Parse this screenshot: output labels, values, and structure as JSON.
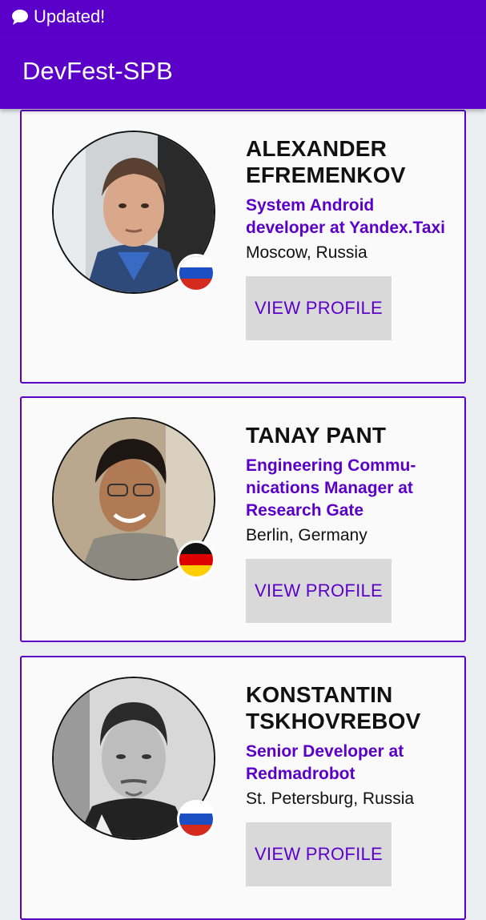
{
  "status_bar": {
    "notification_text": "Updated!"
  },
  "app_bar": {
    "title": "DevFest-SPB"
  },
  "colors": {
    "primary": "#5a00c8",
    "button_bg": "#d9d9d9",
    "card_bg": "#fafafa"
  },
  "speakers": [
    {
      "name": "ALEXANDER EFREMENKOV",
      "title": "System Android developer at Yandex.Taxi",
      "location": "Moscow, Russia",
      "flag": "russia-flag-icon",
      "button_label": "VIEW PROFILE"
    },
    {
      "name": "TANAY PANT",
      "title": "Engineering Commu-nications Manager at Research Gate",
      "location": "Berlin, Germany",
      "flag": "germany-flag-icon",
      "button_label": "VIEW PROFILE"
    },
    {
      "name": "KONSTANTIN TSKHOVREBOV",
      "title": "Senior Developer at Redmadrobot",
      "location": "St. Petersburg, Russia",
      "flag": "russia-flag-icon",
      "button_label": "VIEW PROFILE"
    }
  ]
}
